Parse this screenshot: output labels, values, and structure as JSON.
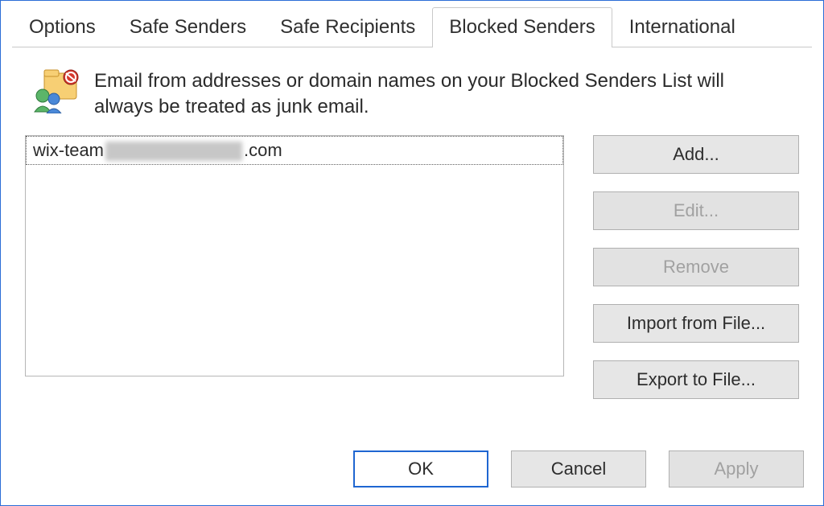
{
  "tabs": {
    "options": "Options",
    "safe_senders": "Safe Senders",
    "safe_recipients": "Safe Recipients",
    "blocked_senders": "Blocked Senders",
    "international": "International",
    "active": "blocked_senders"
  },
  "intro": {
    "text": "Email from addresses or domain names on your Blocked Senders List will always be treated as junk email."
  },
  "list": {
    "items": [
      {
        "left": "wix-team",
        "right": ".com"
      }
    ]
  },
  "side_buttons": {
    "add": {
      "label": "Add...",
      "enabled": true
    },
    "edit": {
      "label": "Edit...",
      "enabled": false
    },
    "remove": {
      "label": "Remove",
      "enabled": false
    },
    "import": {
      "label": "Import from File...",
      "enabled": true
    },
    "export": {
      "label": "Export to File...",
      "enabled": true
    }
  },
  "dialog_buttons": {
    "ok": {
      "label": "OK",
      "primary": true,
      "enabled": true
    },
    "cancel": {
      "label": "Cancel",
      "primary": false,
      "enabled": true
    },
    "apply": {
      "label": "Apply",
      "primary": false,
      "enabled": false
    }
  },
  "icons": {
    "intro": "blocked-senders-icon"
  }
}
